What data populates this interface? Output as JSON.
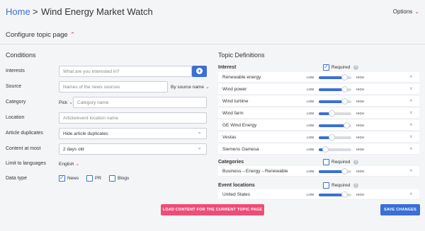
{
  "header": {
    "home": "Home",
    "separator": ">",
    "title": "Wind Energy Market Watch",
    "options": "Options"
  },
  "configure": {
    "label": "Configure topic page"
  },
  "conditions": {
    "title": "Conditions",
    "interests": {
      "label": "Interests",
      "placeholder": "What are you interested in?"
    },
    "source": {
      "label": "Source",
      "placeholder": "Names of the news sources",
      "mode": "By source name"
    },
    "category": {
      "label": "Category",
      "pick": "Pick",
      "placeholder": "Category name"
    },
    "location": {
      "label": "Location",
      "placeholder": "Article/event location name"
    },
    "duplicates": {
      "label": "Article duplicates",
      "value": "Hide article duplicates"
    },
    "content_at_most": {
      "label": "Content at most",
      "value": "2 days old"
    },
    "languages": {
      "label": "Limit to languages",
      "value": "English"
    },
    "data_type": {
      "label": "Data type",
      "options": [
        {
          "label": "News",
          "checked": true
        },
        {
          "label": "PR",
          "checked": false
        },
        {
          "label": "Blogs",
          "checked": false
        }
      ]
    }
  },
  "definitions": {
    "title": "Topic Definitions",
    "low": "LOW",
    "high": "HIGH",
    "interest": {
      "heading": "Interest",
      "required": "Required",
      "required_checked": true,
      "items": [
        {
          "name": "Renewable energy",
          "level": 0.78
        },
        {
          "name": "Wind power",
          "level": 0.78
        },
        {
          "name": "Wind turbine",
          "level": 0.78
        },
        {
          "name": "Wind farm",
          "level": 0.4
        },
        {
          "name": "GE Wind Energy",
          "level": 0.85
        },
        {
          "name": "Vestas",
          "level": 0.4
        },
        {
          "name": "Siemens Gamesa",
          "level": 0.2
        }
      ]
    },
    "categories": {
      "heading": "Categories",
      "required": "Required",
      "required_checked": false,
      "items": [
        {
          "name": "Business→Energy→Renewable",
          "level": 0.78
        }
      ]
    },
    "event_locations": {
      "heading": "Event locations",
      "required": "Required",
      "required_checked": false,
      "items": [
        {
          "name": "United States",
          "level": 0.78
        }
      ]
    }
  },
  "actions": {
    "load": "LOAD CONTENT FOR THE CURRENT TOPIC PAGE",
    "save": "SAVE CHANGES"
  },
  "colors": {
    "accent": "#3a6fd8",
    "pink": "#ee4d78",
    "caret": "#e6335a"
  }
}
